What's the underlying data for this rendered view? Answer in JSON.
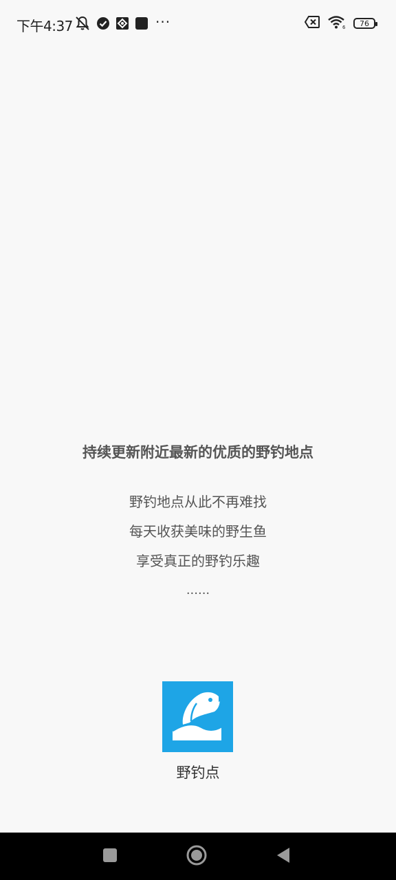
{
  "status_bar": {
    "time": "下午4:37",
    "more": "···",
    "battery": "76",
    "icons_left": [
      "mute-bell-icon",
      "check-circle-icon",
      "app-notification-icon",
      "square-notification-icon"
    ],
    "icons_right": [
      "sim-x-icon",
      "wifi-icon",
      "battery-icon"
    ]
  },
  "splash": {
    "tagline": "持续更新附近最新的优质的野钓地点",
    "features": [
      "野钓地点从此不再难找",
      "每天收获美味的野生鱼",
      "享受真正的野钓乐趣"
    ],
    "ellipsis": "......",
    "app_name": "野钓点",
    "app_icon": "fish-water-icon",
    "icon_color": "#1ea5e6"
  },
  "nav_bar": {
    "buttons": [
      "recents-square-icon",
      "home-circle-icon",
      "back-triangle-icon"
    ]
  }
}
